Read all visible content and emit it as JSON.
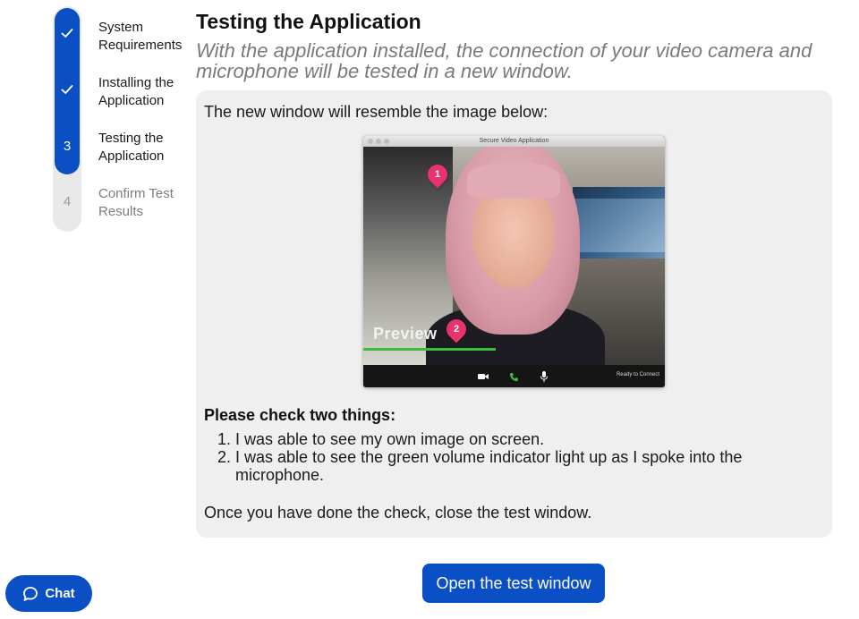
{
  "stepper": {
    "steps": [
      {
        "label": "System Requirements",
        "status": "complete",
        "marker": "check-icon"
      },
      {
        "label": "Installing the Application",
        "status": "complete",
        "marker": "check-icon"
      },
      {
        "label": "Testing the Application",
        "status": "active",
        "marker": "3"
      },
      {
        "label": "Confirm Test Results",
        "status": "pending",
        "marker": "4"
      }
    ]
  },
  "main": {
    "title": "Testing the Application",
    "subtitle": "With the application installed, the connection of your video camera and microphone will be tested in a new window.",
    "intro": "The new window will resemble the image below:",
    "preview_window": {
      "title": "Secure Video Application",
      "overlay_label": "Preview",
      "status": "Ready to Connect",
      "pins": [
        "1",
        "2"
      ],
      "toolbar_icons": [
        "video-camera-icon",
        "phone-icon",
        "microphone-icon"
      ]
    },
    "check_heading": "Please check two things:",
    "checks": [
      "I was able to see my own image on screen.",
      "I was able to see the green volume indicator light up as I spoke into the microphone."
    ],
    "closing": "Once you have done the check, close the test window.",
    "open_button_label": "Open the test window"
  },
  "chat": {
    "label": "Chat",
    "icon": "chat-bubble-icon"
  },
  "colors": {
    "accent": "#0b4fc4",
    "card_bg": "#efefef",
    "pin": "#e8336e",
    "volume": "#3bbf3b"
  }
}
